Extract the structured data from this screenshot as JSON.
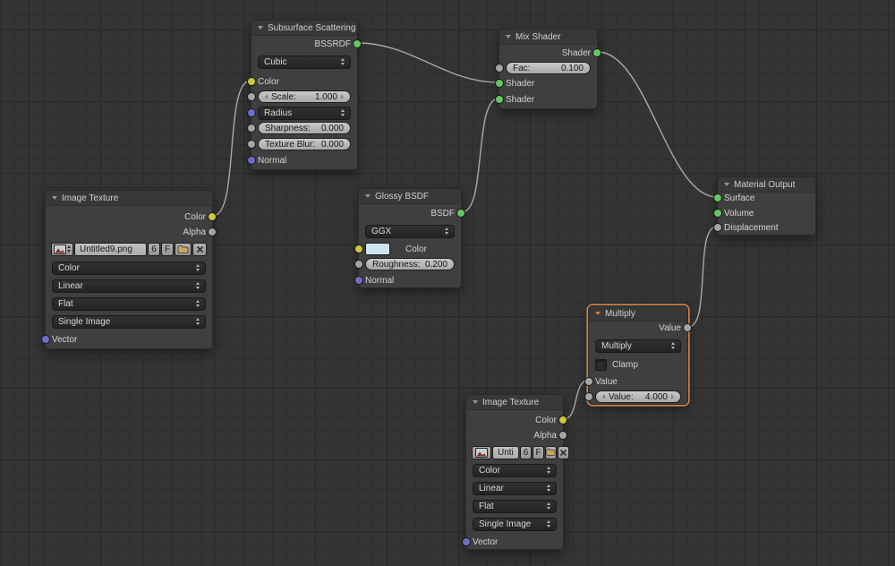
{
  "colors": {
    "socket_shader": "#63c763",
    "socket_color": "#cdc83a",
    "socket_value": "#a5a5a5",
    "socket_vector": "#6d6dc9",
    "wire": "#ababab",
    "selection_outline": "#d08748",
    "glossy_color_swatch": "#cfe6f0"
  },
  "nodes": {
    "image_texture_1": {
      "title": "Image Texture",
      "out_color": "Color",
      "out_alpha": "Alpha",
      "image_name": "Untitled9.png",
      "users_count": "6",
      "fake_user": "F",
      "color_space": "Color",
      "interpolation": "Linear",
      "projection": "Flat",
      "source": "Single Image",
      "in_vector": "Vector"
    },
    "subsurface": {
      "title": "Subsurface Scattering",
      "out_bssrdf": "BSSRDF",
      "falloff": "Cubic",
      "in_color": "Color",
      "scale_label": "Scale:",
      "scale_value": "1.000",
      "radius": "Radius",
      "sharpness_label": "Sharpness:",
      "sharpness_value": "0.000",
      "texture_blur_label": "Texture Blur:",
      "texture_blur_value": "0.000",
      "in_normal": "Normal"
    },
    "mix_shader": {
      "title": "Mix Shader",
      "out_shader": "Shader",
      "fac_label": "Fac:",
      "fac_value": "0.100",
      "in_shader1": "Shader",
      "in_shader2": "Shader"
    },
    "glossy": {
      "title": "Glossy BSDF",
      "out_bsdf": "BSDF",
      "distribution": "GGX",
      "in_color": "Color",
      "roughness_label": "Roughness:",
      "roughness_value": "0.200",
      "in_normal": "Normal"
    },
    "material_output": {
      "title": "Material Output",
      "in_surface": "Surface",
      "in_volume": "Volume",
      "in_displacement": "Displacement"
    },
    "math_multiply": {
      "title": "Multiply",
      "out_value": "Value",
      "operation": "Multiply",
      "clamp_label": "Clamp",
      "in_value": "Value",
      "value_label": "Value:",
      "value_value": "4.000"
    },
    "image_texture_2": {
      "title": "Image Texture",
      "out_color": "Color",
      "out_alpha": "Alpha",
      "image_name": "Unti",
      "users_count": "6",
      "fake_user": "F",
      "color_space": "Color",
      "interpolation": "Linear",
      "projection": "Flat",
      "source": "Single Image",
      "in_vector": "Vector"
    }
  }
}
